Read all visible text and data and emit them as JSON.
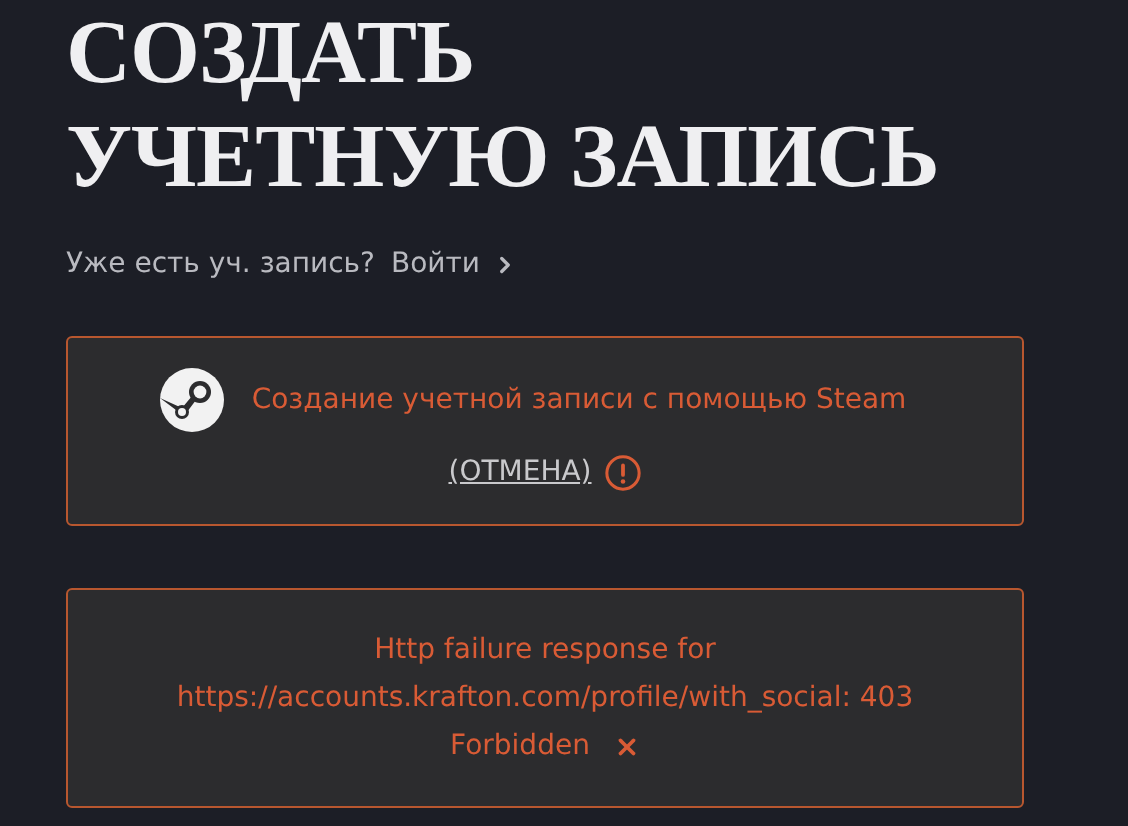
{
  "title_lines": [
    "СОЗДАТЬ",
    "УЧЕТНУЮ ЗАПИСЬ"
  ],
  "login_prompt": {
    "question": "Уже есть уч. запись?",
    "link": "Войти"
  },
  "steam_notice": {
    "message": "Создание учетной записи с помощью Steam",
    "cancel": "(ОТМЕНА)"
  },
  "error_notice": {
    "lines": [
      "Http failure response for",
      "https://accounts.krafton.com/profile/with_social: 403",
      "Forbidden"
    ]
  }
}
